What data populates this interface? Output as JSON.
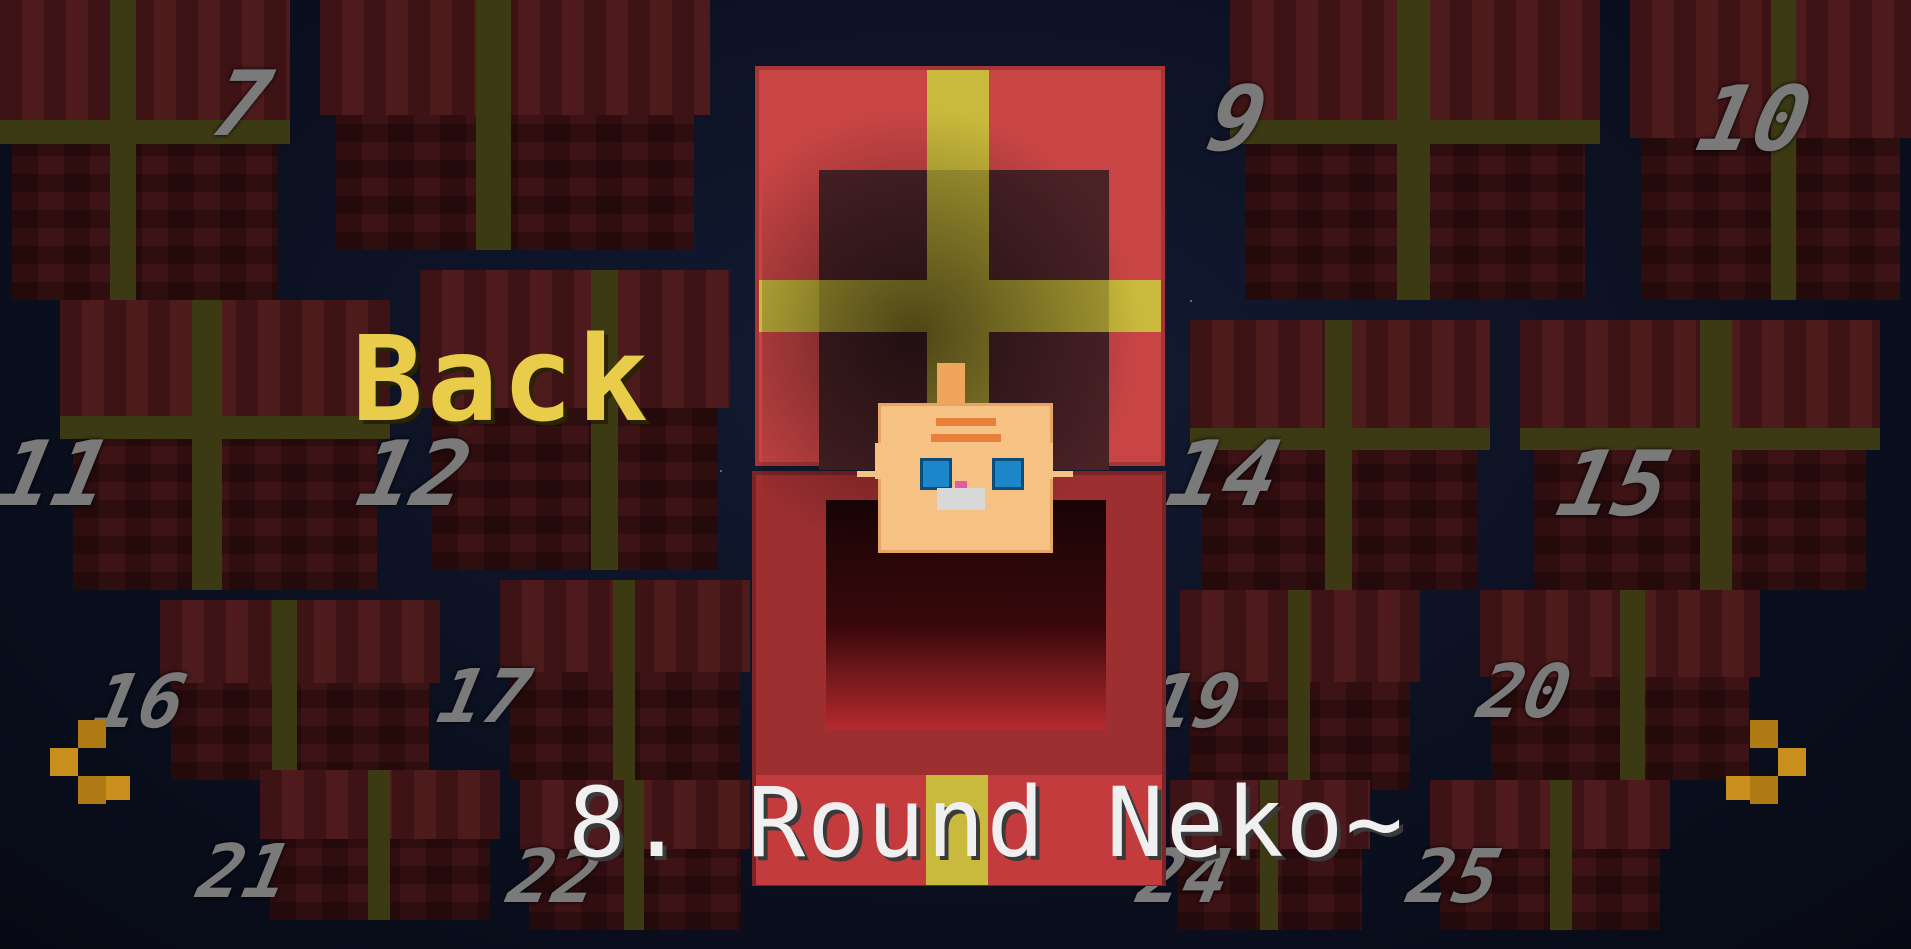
{
  "ui": {
    "back_label": "Back",
    "current_item_title": "8. Round Neko~",
    "prev_arrow": "arrow-left-icon",
    "next_arrow": "arrow-right-icon"
  },
  "gift_numbers": [
    "7",
    "9",
    "10",
    "11",
    "12",
    "14",
    "15",
    "16",
    "17",
    "19",
    "20",
    "21",
    "22",
    "24",
    "25"
  ],
  "colors": {
    "back_text": "#e8cc4a",
    "title_text": "#f0f0f0",
    "gift_red": "#c94545",
    "ribbon_yellow": "#c9b93c",
    "cat_orange": "#f6c284",
    "arrow_gold": "#c98f1c"
  }
}
